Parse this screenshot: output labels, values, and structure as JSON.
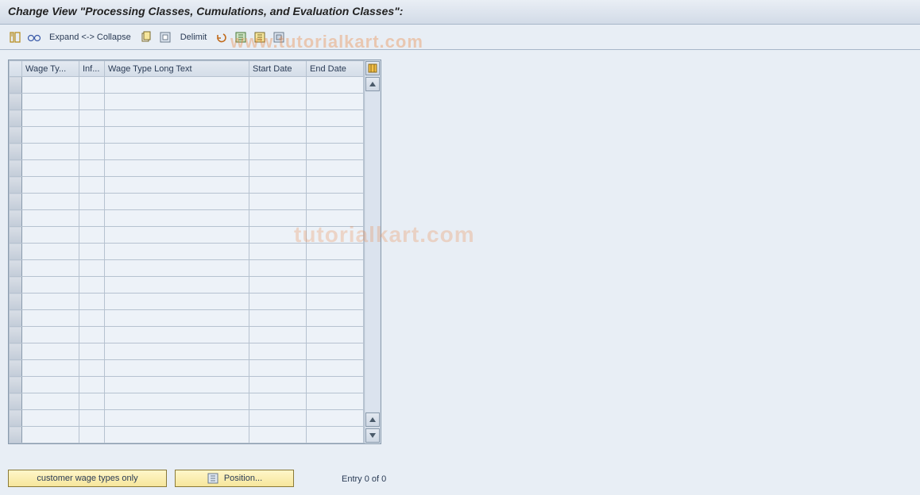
{
  "title": "Change View \"Processing Classes, Cumulations, and Evaluation Classes\":",
  "toolbar": {
    "expand_collapse_label": "Expand <-> Collapse",
    "delimit_label": "Delimit",
    "icons": {
      "toggle": "toggle-icon",
      "glasses": "glasses-icon",
      "copy": "copy-icon",
      "paste": "paste-icon",
      "undo": "undo-icon",
      "select_all": "select-all-icon",
      "deselect_all": "deselect-all-icon",
      "config": "configure-icon"
    }
  },
  "grid": {
    "columns": {
      "wage_type": "Wage Ty...",
      "inf": "Inf...",
      "long_text": "Wage Type Long Text",
      "start_date": "Start Date",
      "end_date": "End Date"
    },
    "rows": [
      {
        "wage_type": "",
        "inf": "",
        "long_text": "",
        "start_date": "",
        "end_date": ""
      },
      {
        "wage_type": "",
        "inf": "",
        "long_text": "",
        "start_date": "",
        "end_date": ""
      },
      {
        "wage_type": "",
        "inf": "",
        "long_text": "",
        "start_date": "",
        "end_date": ""
      },
      {
        "wage_type": "",
        "inf": "",
        "long_text": "",
        "start_date": "",
        "end_date": ""
      },
      {
        "wage_type": "",
        "inf": "",
        "long_text": "",
        "start_date": "",
        "end_date": ""
      },
      {
        "wage_type": "",
        "inf": "",
        "long_text": "",
        "start_date": "",
        "end_date": ""
      },
      {
        "wage_type": "",
        "inf": "",
        "long_text": "",
        "start_date": "",
        "end_date": ""
      },
      {
        "wage_type": "",
        "inf": "",
        "long_text": "",
        "start_date": "",
        "end_date": ""
      },
      {
        "wage_type": "",
        "inf": "",
        "long_text": "",
        "start_date": "",
        "end_date": ""
      },
      {
        "wage_type": "",
        "inf": "",
        "long_text": "",
        "start_date": "",
        "end_date": ""
      },
      {
        "wage_type": "",
        "inf": "",
        "long_text": "",
        "start_date": "",
        "end_date": ""
      },
      {
        "wage_type": "",
        "inf": "",
        "long_text": "",
        "start_date": "",
        "end_date": ""
      },
      {
        "wage_type": "",
        "inf": "",
        "long_text": "",
        "start_date": "",
        "end_date": ""
      },
      {
        "wage_type": "",
        "inf": "",
        "long_text": "",
        "start_date": "",
        "end_date": ""
      },
      {
        "wage_type": "",
        "inf": "",
        "long_text": "",
        "start_date": "",
        "end_date": ""
      },
      {
        "wage_type": "",
        "inf": "",
        "long_text": "",
        "start_date": "",
        "end_date": ""
      },
      {
        "wage_type": "",
        "inf": "",
        "long_text": "",
        "start_date": "",
        "end_date": ""
      },
      {
        "wage_type": "",
        "inf": "",
        "long_text": "",
        "start_date": "",
        "end_date": ""
      },
      {
        "wage_type": "",
        "inf": "",
        "long_text": "",
        "start_date": "",
        "end_date": ""
      },
      {
        "wage_type": "",
        "inf": "",
        "long_text": "",
        "start_date": "",
        "end_date": ""
      },
      {
        "wage_type": "",
        "inf": "",
        "long_text": "",
        "start_date": "",
        "end_date": ""
      },
      {
        "wage_type": "",
        "inf": "",
        "long_text": "",
        "start_date": "",
        "end_date": ""
      }
    ]
  },
  "footer": {
    "customer_button": "customer wage types only",
    "position_button": "Position...",
    "status_text": "Entry 0 of 0"
  },
  "watermark": {
    "text1": "www.tutorialkart.com",
    "text2": "tutorialkart.com"
  },
  "colors": {
    "bg": "#e8eef5",
    "border": "#8a9bad",
    "accent_btn": "#f6e69c",
    "header_grad_top": "#e9eef5",
    "header_grad_bot": "#d2dbe7"
  }
}
